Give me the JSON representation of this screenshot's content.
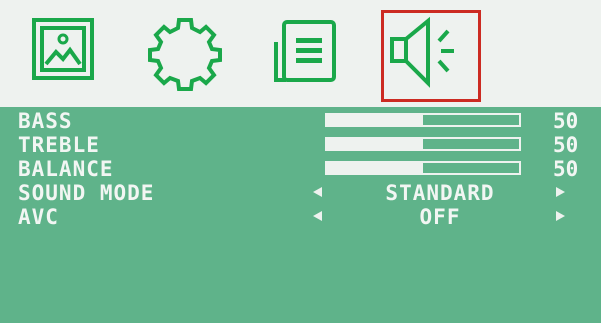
{
  "tabs": [
    {
      "icon": "picture-icon",
      "selected": false
    },
    {
      "icon": "gear-icon",
      "selected": false
    },
    {
      "icon": "document-icon",
      "selected": false
    },
    {
      "icon": "speaker-icon",
      "selected": true
    }
  ],
  "colors": {
    "icon_green": "#1aa84a",
    "menu_background": "#5fb38a",
    "selected_outline": "#cc2b22",
    "text": "#f2f6f3"
  },
  "menu": {
    "bass": {
      "label": "BASS",
      "value": "50",
      "level": 0.5
    },
    "treble": {
      "label": "TREBLE",
      "value": "50",
      "level": 0.5
    },
    "balance": {
      "label": "BALANCE",
      "value": "50",
      "level": 0.5
    },
    "sound_mode": {
      "label": "SOUND MODE",
      "value": "STANDARD"
    },
    "avc": {
      "label": "AVC",
      "value": "OFF"
    }
  }
}
